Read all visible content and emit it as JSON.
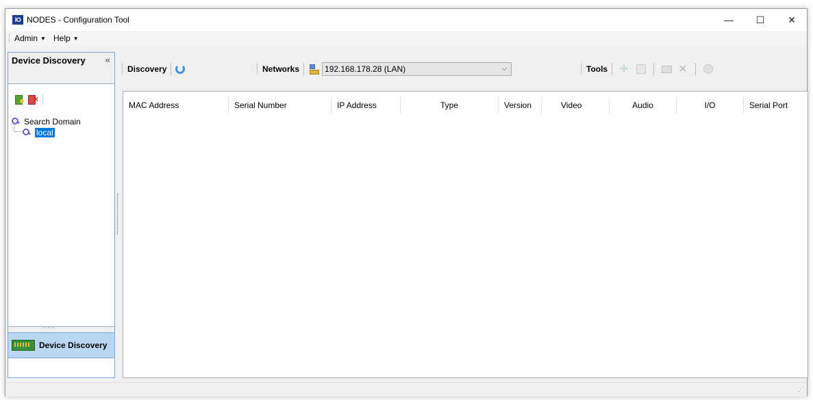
{
  "window": {
    "title": "NODES - Configuration Tool",
    "app_icon_text": "IO"
  },
  "window_controls": {
    "minimize": "—",
    "maximize": "☐",
    "close": "✕"
  },
  "menu": {
    "items": [
      {
        "label": "Admin"
      },
      {
        "label": "Help"
      }
    ]
  },
  "left_panel": {
    "title": "Device Discovery",
    "collapse_glyph": "«",
    "tree": {
      "root": "Search Domain",
      "child": "local"
    },
    "nav_button": "Device Discovery"
  },
  "toolbar": {
    "discovery_label": "Discovery",
    "networks_label": "Networks",
    "network_selected": "192.168.178.28 (LAN)",
    "tools_label": "Tools"
  },
  "grid": {
    "columns": [
      "MAC Address",
      "Serial Number",
      "IP Address",
      "Type",
      "Version",
      "Video",
      "Audio",
      "I/O",
      "Serial Port"
    ],
    "rows": []
  },
  "colors": {
    "accent": "#0078d7",
    "nav_highlight": "#b9d7f2",
    "panel_border": "#7aa7d6"
  }
}
